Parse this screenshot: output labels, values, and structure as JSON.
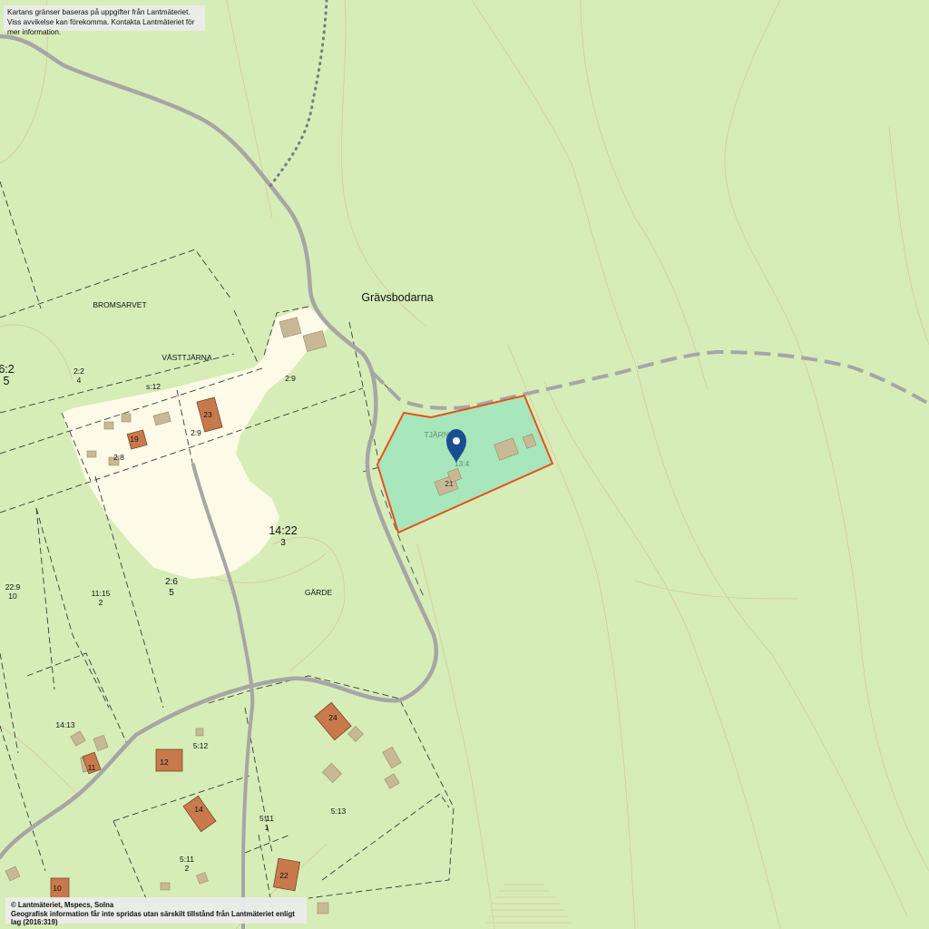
{
  "notice": {
    "line1": "Kartans gränser baseras på uppgifter från Lantmäteriet.",
    "line2": "Viss avvikelse kan förekomma. Kontakta Lantmäteriet för mer information."
  },
  "copyright": {
    "line1": "© Lantmäteriet, Mspecs, Solna",
    "line2": "Geografisk information får inte spridas utan särskilt tillstånd från Lantmäteriet enligt lag (2016:319)"
  },
  "colors": {
    "land": "#d6edb8",
    "clearing": "#fdfbe8",
    "property_fill": "#a8e6bb",
    "property_border": "#e8501e",
    "marker": "#1a4f8f",
    "road": "#a6a6a6",
    "building_main": "#c87a4c",
    "building_aux": "#c8b896"
  },
  "places": {
    "gravsbodarna": "Grävsbodarna",
    "bromsarvet": "BROMSARVET",
    "vasttjarna": "VÄSTTJÄRNA",
    "tjarna": "TJÄRNA",
    "garde": "GÄRDE"
  },
  "marker_icon": "map-pin-icon",
  "property": {
    "designation": "13:4",
    "building_number": "21"
  },
  "parcels": {
    "p_6_2_a": "6:2",
    "p_6_2_b": "5",
    "p_2_2_a": "2:2",
    "p_2_2_b": "4",
    "p_s12": "s:12",
    "p_2_9_upper": "2:9",
    "p_2_9_lower": "2:9",
    "p_2_8": "2:8",
    "p_14_22_a": "14:22",
    "p_14_22_b": "3",
    "p_2_6_a": "2:6",
    "p_2_6_b": "5",
    "p_22_9_a": "22:9",
    "p_22_9_b": "10",
    "p_11_15_a": "11:15",
    "p_11_15_b": "2",
    "p_14_13": "14:13",
    "p_5_12": "5:12",
    "p_5_13": "5:13",
    "p_5_11a_a": "5:11",
    "p_5_11a_b": "1",
    "p_5_11b_a": "5:11",
    "p_5_11b_b": "2"
  },
  "house_numbers": {
    "h23": "23",
    "h19": "19",
    "h24": "24",
    "h12": "12",
    "h11": "11",
    "h14": "14",
    "h22": "22",
    "h10": "10"
  }
}
